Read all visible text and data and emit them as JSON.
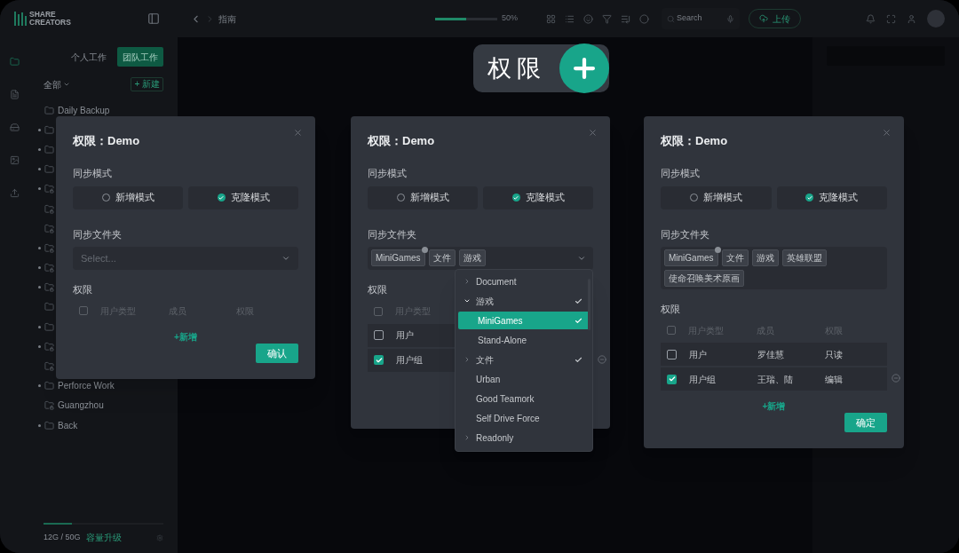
{
  "logo": {
    "line1": "SHARE",
    "line2": "CREATORS"
  },
  "toolbar": {
    "breadcrumb": "指南",
    "zoom": {
      "level": 0.5,
      "reading": "50%"
    },
    "search": {
      "placeholder": "Search"
    },
    "upload": "上传"
  },
  "rail": [
    {
      "kind": "folder",
      "selected": true
    },
    {
      "kind": "list",
      "selected": false
    },
    {
      "kind": "drive",
      "selected": false
    },
    {
      "kind": "image",
      "selected": false
    },
    {
      "kind": "upload",
      "selected": false
    }
  ],
  "sidebar": {
    "tabs": [
      {
        "label": "个人工作",
        "selected": false
      },
      {
        "label": "团队工作",
        "selected": true
      }
    ],
    "filter": "全部",
    "new": "+ 新建",
    "items": [
      {
        "name": "Daily Backup",
        "kind": "folder",
        "expandable": false
      },
      {
        "kind": "folder",
        "expandable": true
      },
      {
        "kind": "folder",
        "expandable": true
      },
      {
        "kind": "folder",
        "expandable": true
      },
      {
        "kind": "lock",
        "expandable": true
      },
      {
        "kind": "lock",
        "expandable": false
      },
      {
        "kind": "lock",
        "expandable": false
      },
      {
        "kind": "lock",
        "expandable": true
      },
      {
        "kind": "lock",
        "expandable": true
      },
      {
        "kind": "lock",
        "expandable": true
      },
      {
        "kind": "folder",
        "expandable": false
      },
      {
        "kind": "folder",
        "expandable": true
      },
      {
        "kind": "lock",
        "expandable": true
      },
      {
        "kind": "lock",
        "expandable": false
      },
      {
        "name": "Perforce Work",
        "kind": "folder",
        "expandable": true
      },
      {
        "name": "Guangzhou",
        "kind": "lock",
        "expandable": false
      },
      {
        "name": "Back",
        "kind": "folder",
        "expandable": true
      }
    ],
    "storage": {
      "level": 0.24,
      "reading": "12G / 50G",
      "upgrade": "容量升级"
    }
  },
  "feature_chip": {
    "label": "权限"
  },
  "dialogs": [
    {
      "title": "权限：Demo",
      "mode_label": "同步模式",
      "modes": [
        {
          "label": "新增模式",
          "selected": false
        },
        {
          "label": "克隆模式",
          "selected": true
        }
      ],
      "folder_label": "同步文件夹",
      "folder": {
        "placeholder": "Select..."
      },
      "permission_label": "权限",
      "header_checked": false,
      "columns": [
        "用户类型",
        "成员",
        "权限"
      ],
      "add": "+新增",
      "confirm": "确认"
    },
    {
      "title": "权限：Demo",
      "mode_label": "同步模式",
      "modes": [
        {
          "label": "新增模式",
          "selected": false
        },
        {
          "label": "克隆模式",
          "selected": true
        }
      ],
      "folder_label": "同步文件夹",
      "folder": {
        "tags": [
          "MiniGames",
          "文件",
          "游戏"
        ]
      },
      "permission_label": "权限",
      "header_checked": false,
      "columns": [
        "用户类型"
      ],
      "rows": [
        {
          "checked": false,
          "cells": [
            "用户"
          ]
        },
        {
          "checked": true,
          "cells": [
            "用户组"
          ]
        }
      ],
      "dropdown": [
        {
          "label": "Document",
          "expandable": true,
          "expanded": false,
          "checked": false,
          "selected": false
        },
        {
          "label": "游戏",
          "expandable": true,
          "expanded": true,
          "checked": true,
          "selected": false,
          "children": [
            {
              "label": "MiniGames",
              "checked": true,
              "selected": true
            },
            {
              "label": "Stand-Alone",
              "checked": false,
              "selected": false
            }
          ]
        },
        {
          "label": "文件",
          "expandable": true,
          "expanded": false,
          "checked": true,
          "selected": false
        },
        {
          "label": "Urban",
          "expandable": false,
          "checked": false,
          "selected": false
        },
        {
          "label": "Good Teamork",
          "expandable": false,
          "checked": false,
          "selected": false
        },
        {
          "label": "Self Drive Force",
          "expandable": false,
          "checked": false,
          "selected": false
        },
        {
          "label": "Readonly",
          "expandable": true,
          "expanded": false,
          "checked": false,
          "selected": false
        }
      ]
    },
    {
      "title": "权限：Demo",
      "mode_label": "同步模式",
      "modes": [
        {
          "label": "新增模式",
          "selected": false
        },
        {
          "label": "克隆模式",
          "selected": true
        }
      ],
      "folder_label": "同步文件夹",
      "folder": {
        "tags": [
          "MiniGames",
          "文件",
          "游戏",
          "英雄联盟",
          "使命召唤美术原画"
        ]
      },
      "permission_label": "权限",
      "header_checked": false,
      "columns": [
        "用户类型",
        "成员",
        "权限"
      ],
      "rows": [
        {
          "checked": false,
          "cells": [
            "用户",
            "罗佳慧",
            "只读"
          ]
        },
        {
          "checked": true,
          "cells": [
            "用户组",
            "王瑞、陆",
            "编辑"
          ]
        }
      ],
      "add": "+新增",
      "confirm": "确定"
    }
  ]
}
